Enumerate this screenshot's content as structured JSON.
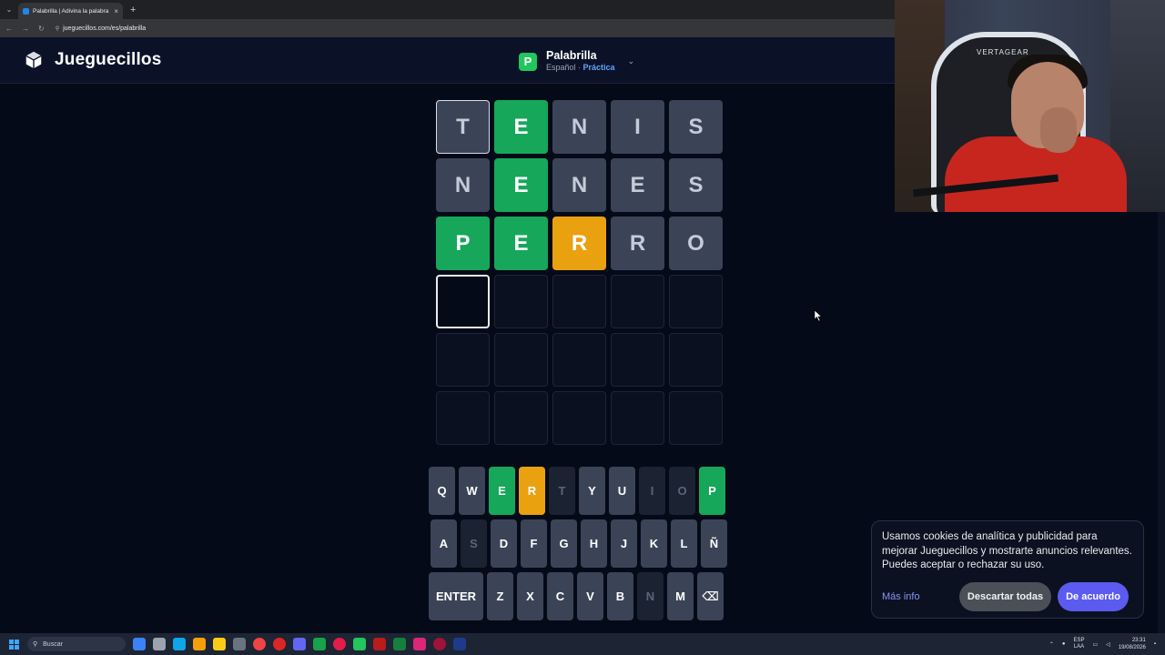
{
  "browser": {
    "tab_title": "Palabrilla | Adivina la palabra d",
    "url": "jueguecillos.com/es/palabrilla",
    "new_tab": "+",
    "tab_close": "×"
  },
  "header": {
    "brand": "Jueguecillos",
    "game_icon_letter": "P",
    "game_name": "Palabrilla",
    "language": "Español · ",
    "mode": "Práctica"
  },
  "board": {
    "rows": [
      [
        {
          "letter": "T",
          "state": "absent",
          "outlined": true
        },
        {
          "letter": "E",
          "state": "correct"
        },
        {
          "letter": "N",
          "state": "absent"
        },
        {
          "letter": "I",
          "state": "absent"
        },
        {
          "letter": "S",
          "state": "absent"
        }
      ],
      [
        {
          "letter": "N",
          "state": "absent"
        },
        {
          "letter": "E",
          "state": "correct"
        },
        {
          "letter": "N",
          "state": "absent"
        },
        {
          "letter": "E",
          "state": "absent"
        },
        {
          "letter": "S",
          "state": "absent"
        }
      ],
      [
        {
          "letter": "P",
          "state": "correct"
        },
        {
          "letter": "E",
          "state": "correct"
        },
        {
          "letter": "R",
          "state": "present"
        },
        {
          "letter": "R",
          "state": "absent"
        },
        {
          "letter": "O",
          "state": "absent"
        }
      ],
      [
        {
          "letter": "",
          "state": "active"
        },
        {
          "letter": "",
          "state": "empty"
        },
        {
          "letter": "",
          "state": "empty"
        },
        {
          "letter": "",
          "state": "empty"
        },
        {
          "letter": "",
          "state": "empty"
        }
      ],
      [
        {
          "letter": "",
          "state": "empty"
        },
        {
          "letter": "",
          "state": "empty"
        },
        {
          "letter": "",
          "state": "empty"
        },
        {
          "letter": "",
          "state": "empty"
        },
        {
          "letter": "",
          "state": "empty"
        }
      ],
      [
        {
          "letter": "",
          "state": "empty"
        },
        {
          "letter": "",
          "state": "empty"
        },
        {
          "letter": "",
          "state": "empty"
        },
        {
          "letter": "",
          "state": "empty"
        },
        {
          "letter": "",
          "state": "empty"
        }
      ]
    ]
  },
  "keyboard": {
    "rows": [
      [
        {
          "key": "Q",
          "state": "unused"
        },
        {
          "key": "W",
          "state": "unused"
        },
        {
          "key": "E",
          "state": "correct"
        },
        {
          "key": "R",
          "state": "present"
        },
        {
          "key": "T",
          "state": "absent"
        },
        {
          "key": "Y",
          "state": "unused"
        },
        {
          "key": "U",
          "state": "unused"
        },
        {
          "key": "I",
          "state": "absent"
        },
        {
          "key": "O",
          "state": "absent"
        },
        {
          "key": "P",
          "state": "correct"
        }
      ],
      [
        {
          "key": "A",
          "state": "unused"
        },
        {
          "key": "S",
          "state": "absent"
        },
        {
          "key": "D",
          "state": "unused"
        },
        {
          "key": "F",
          "state": "unused"
        },
        {
          "key": "G",
          "state": "unused"
        },
        {
          "key": "H",
          "state": "unused"
        },
        {
          "key": "J",
          "state": "unused"
        },
        {
          "key": "K",
          "state": "unused"
        },
        {
          "key": "L",
          "state": "unused"
        },
        {
          "key": "Ñ",
          "state": "unused"
        }
      ],
      [
        {
          "key": "ENTER",
          "state": "unused",
          "wide": true
        },
        {
          "key": "Z",
          "state": "unused"
        },
        {
          "key": "X",
          "state": "unused"
        },
        {
          "key": "C",
          "state": "unused"
        },
        {
          "key": "V",
          "state": "unused"
        },
        {
          "key": "B",
          "state": "unused"
        },
        {
          "key": "N",
          "state": "absent"
        },
        {
          "key": "M",
          "state": "unused"
        },
        {
          "key": "⌫",
          "state": "unused",
          "icon": "backspace-icon"
        }
      ]
    ]
  },
  "webcam": {
    "chair_brand": "VERTAGEAR"
  },
  "cookie": {
    "text": "Usamos cookies de analítica y publicidad para mejorar Jueguecillos y mostrarte anuncios relevantes. Puedes aceptar o rechazar su uso.",
    "more_info": "Más info",
    "reject": "Descartar todas",
    "accept": "De acuerdo"
  },
  "taskbar": {
    "search_placeholder": "Buscar",
    "lang_top": "ESP",
    "lang_bottom": "LAA",
    "time": "23:31",
    "date": "19/08/2026"
  },
  "colors": {
    "correct": "#16a75a",
    "present": "#e9a110",
    "absent": "#3b4457",
    "accent": "#5b5bf0"
  }
}
